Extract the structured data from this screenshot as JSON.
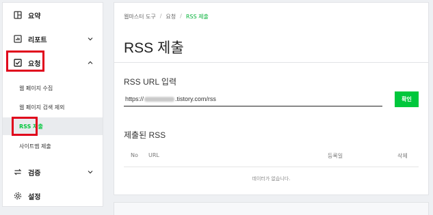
{
  "sidebar": {
    "items": [
      {
        "label": "요약",
        "icon": "dashboard-icon"
      },
      {
        "label": "리포트",
        "icon": "report-icon"
      },
      {
        "label": "요청",
        "icon": "request-check-icon"
      },
      {
        "label": "검증",
        "icon": "verify-icon"
      },
      {
        "label": "설정",
        "icon": "gear-icon"
      }
    ],
    "sub_items": [
      {
        "label": "웹 페이지 수집"
      },
      {
        "label": "웹 페이지 검색 제외"
      },
      {
        "label": "RSS 제출"
      },
      {
        "label": "사이트맵 제출"
      }
    ]
  },
  "breadcrumb": {
    "items": [
      "웹마스터 도구",
      "요청",
      "RSS 제출"
    ]
  },
  "page": {
    "title": "RSS 제출"
  },
  "rss_form": {
    "label": "RSS URL 입력",
    "url_prefix": "https://",
    "url_suffix": ".tistory.com/rss",
    "confirm_label": "확인"
  },
  "submitted": {
    "title": "제출된 RSS",
    "columns": [
      "No",
      "URL",
      "등록일",
      "삭제"
    ],
    "empty_text": "데이터가 없습니다."
  },
  "colors": {
    "accent": "#00c73c",
    "highlight": "#e0001b"
  }
}
